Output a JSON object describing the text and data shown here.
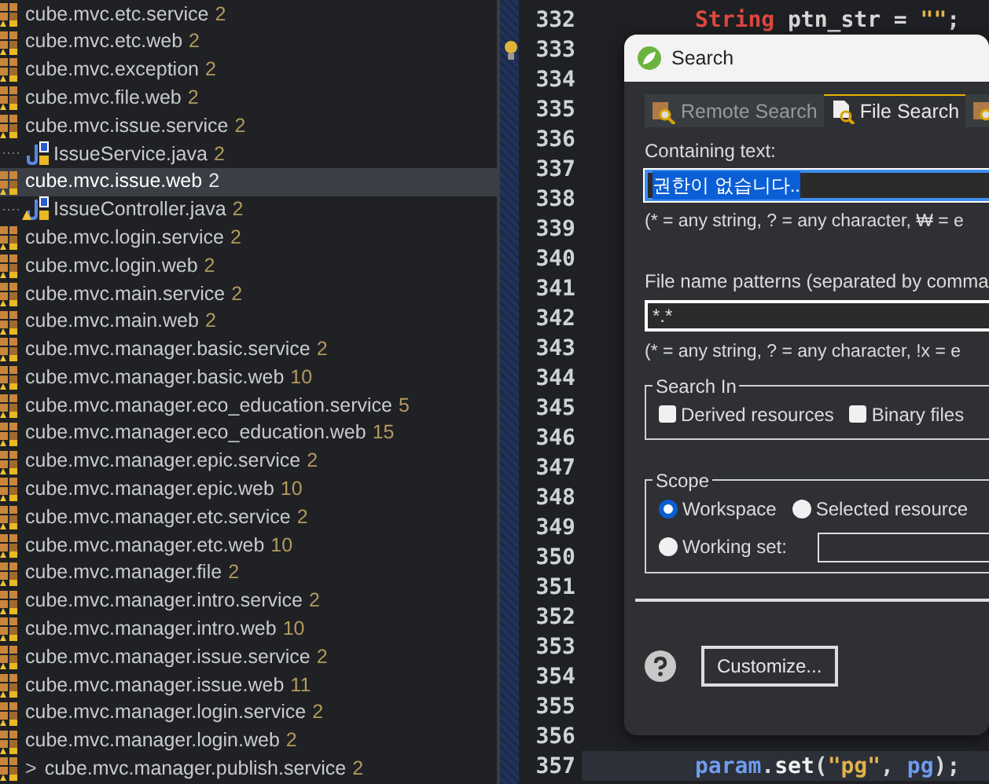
{
  "package_explorer": {
    "items": [
      {
        "label": "cube.mvc.etc.service",
        "count": "2",
        "selected": false
      },
      {
        "label": "cube.mvc.etc.web",
        "count": "2",
        "selected": false
      },
      {
        "label": "cube.mvc.exception",
        "count": "2",
        "selected": false
      },
      {
        "label": "cube.mvc.file.web",
        "count": "2",
        "selected": false
      },
      {
        "label": "cube.mvc.issue.service",
        "count": "2",
        "selected": false,
        "children": [
          {
            "label": "IssueService.java",
            "count": "2",
            "selected": false,
            "warning": false
          }
        ]
      },
      {
        "label": "cube.mvc.issue.web",
        "count": "2",
        "selected": true,
        "children": [
          {
            "label": "IssueController.java",
            "count": "2",
            "selected": false,
            "warning": true
          }
        ]
      },
      {
        "label": "cube.mvc.login.service",
        "count": "2",
        "selected": false
      },
      {
        "label": "cube.mvc.login.web",
        "count": "2",
        "selected": false
      },
      {
        "label": "cube.mvc.main.service",
        "count": "2",
        "selected": false
      },
      {
        "label": "cube.mvc.main.web",
        "count": "2",
        "selected": false
      },
      {
        "label": "cube.mvc.manager.basic.service",
        "count": "2",
        "selected": false
      },
      {
        "label": "cube.mvc.manager.basic.web",
        "count": "10",
        "selected": false
      },
      {
        "label": "cube.mvc.manager.eco_education.service",
        "count": "5",
        "selected": false
      },
      {
        "label": "cube.mvc.manager.eco_education.web",
        "count": "15",
        "selected": false
      },
      {
        "label": "cube.mvc.manager.epic.service",
        "count": "2",
        "selected": false
      },
      {
        "label": "cube.mvc.manager.epic.web",
        "count": "10",
        "selected": false
      },
      {
        "label": "cube.mvc.manager.etc.service",
        "count": "2",
        "selected": false
      },
      {
        "label": "cube.mvc.manager.etc.web",
        "count": "10",
        "selected": false
      },
      {
        "label": "cube.mvc.manager.file",
        "count": "2",
        "selected": false
      },
      {
        "label": "cube.mvc.manager.intro.service",
        "count": "2",
        "selected": false
      },
      {
        "label": "cube.mvc.manager.intro.web",
        "count": "10",
        "selected": false
      },
      {
        "label": "cube.mvc.manager.issue.service",
        "count": "2",
        "selected": false
      },
      {
        "label": "cube.mvc.manager.issue.web",
        "count": "11",
        "selected": false
      },
      {
        "label": "cube.mvc.manager.login.service",
        "count": "2",
        "selected": false
      },
      {
        "label": "cube.mvc.manager.login.web",
        "count": "2",
        "selected": false
      },
      {
        "label": "cube.mvc.manager.publish.service",
        "count": "2",
        "selected": false,
        "prefix": ">"
      }
    ]
  },
  "editor": {
    "lines": [
      {
        "number": "332",
        "current": false,
        "quick_fix": false,
        "tokens": [
          {
            "text": "String",
            "kind": "type"
          },
          {
            "text": " ptn_str = ",
            "kind": "plain"
          },
          {
            "text": "\"\"",
            "kind": "string"
          },
          {
            "text": ";",
            "kind": "plain"
          }
        ]
      },
      {
        "number": "333",
        "current": false,
        "quick_fix": true
      },
      {
        "number": "334",
        "current": false,
        "quick_fix": false
      },
      {
        "number": "335",
        "current": false,
        "quick_fix": false
      },
      {
        "number": "336",
        "current": false,
        "quick_fix": false
      },
      {
        "number": "337",
        "current": false,
        "quick_fix": false
      },
      {
        "number": "338",
        "current": false,
        "quick_fix": false
      },
      {
        "number": "339",
        "current": false,
        "quick_fix": false
      },
      {
        "number": "340",
        "current": false,
        "quick_fix": false
      },
      {
        "number": "341",
        "current": false,
        "quick_fix": false
      },
      {
        "number": "342",
        "current": false,
        "quick_fix": false
      },
      {
        "number": "343",
        "current": false,
        "quick_fix": false
      },
      {
        "number": "344",
        "current": false,
        "quick_fix": false
      },
      {
        "number": "345",
        "current": false,
        "quick_fix": false
      },
      {
        "number": "346",
        "current": false,
        "quick_fix": false
      },
      {
        "number": "347",
        "current": false,
        "quick_fix": false
      },
      {
        "number": "348",
        "current": false,
        "quick_fix": false
      },
      {
        "number": "349",
        "current": false,
        "quick_fix": false
      },
      {
        "number": "350",
        "current": false,
        "quick_fix": false
      },
      {
        "number": "351",
        "current": false,
        "quick_fix": false
      },
      {
        "number": "352",
        "current": false,
        "quick_fix": false
      },
      {
        "number": "353",
        "current": false,
        "quick_fix": false
      },
      {
        "number": "354",
        "current": false,
        "quick_fix": false
      },
      {
        "number": "355",
        "current": false,
        "quick_fix": false
      },
      {
        "number": "356",
        "current": false,
        "quick_fix": false
      },
      {
        "number": "357",
        "current": true,
        "quick_fix": false,
        "tokens": [
          {
            "text": "param",
            "kind": "field"
          },
          {
            "text": ".",
            "kind": "plain"
          },
          {
            "text": "set",
            "kind": "method"
          },
          {
            "text": "(",
            "kind": "plain"
          },
          {
            "text": "\"pg\"",
            "kind": "string"
          },
          {
            "text": ", ",
            "kind": "plain"
          },
          {
            "text": "pg",
            "kind": "field"
          },
          {
            "text": ");",
            "kind": "plain"
          }
        ]
      }
    ]
  },
  "dialog": {
    "title": "Search",
    "tabs": [
      {
        "label": "Remote Search",
        "selected": false
      },
      {
        "label": "File Search",
        "selected": true
      },
      {
        "selected": false
      }
    ],
    "containing_text": {
      "label": "Containing text:",
      "value": "권한이 없습니다..",
      "text_selected": true,
      "hint": "(* = any string, ? = any character, ₩ = e"
    },
    "file_name_patterns": {
      "label": "File name patterns (separated by comma",
      "value": "*.*",
      "text_selected": false,
      "hint": "(* = any string, ? = any character, !x = e"
    },
    "search_in": {
      "title": "Search In",
      "options": [
        {
          "label": "Derived resources",
          "checked": false
        },
        {
          "label": "Binary files",
          "checked": false
        }
      ]
    },
    "scope": {
      "title": "Scope",
      "options": [
        {
          "label": "Workspace",
          "selected": true,
          "field": false
        },
        {
          "label": "Selected resource",
          "selected": false,
          "field": false
        },
        {
          "label": "Working set:",
          "selected": false,
          "field": true
        }
      ]
    },
    "customize_button": "Customize..."
  }
}
